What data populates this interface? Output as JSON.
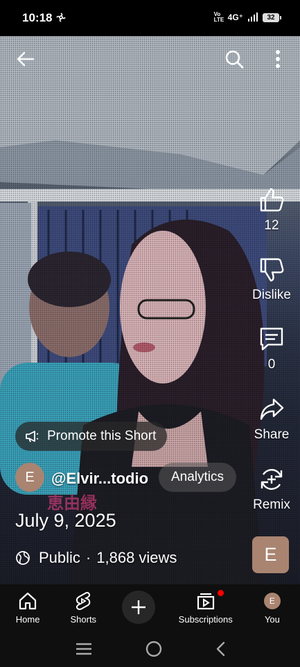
{
  "status_bar": {
    "time": "10:18",
    "network": "4G⁺",
    "volte": "Vo LTE",
    "battery": "32"
  },
  "top_bar": {
    "back_icon": "arrow-left-icon",
    "search_icon": "search-icon",
    "more_icon": "more-vertical-icon"
  },
  "actions": {
    "like_count": "12",
    "dislike_label": "Dislike",
    "comment_count": "0",
    "share_label": "Share",
    "remix_label": "Remix"
  },
  "promote": {
    "label": "Promote this Short",
    "icon": "megaphone-icon"
  },
  "channel": {
    "avatar_letter": "E",
    "handle": "@Elvir...todio",
    "analytics_label": "Analytics",
    "thumb_letter": "E"
  },
  "video_info": {
    "date": "July 9, 2025",
    "visibility": "Public",
    "separator": "·",
    "views": "1,868 views"
  },
  "bottom_nav": {
    "home": "Home",
    "shorts": "Shorts",
    "subscriptions": "Subscriptions",
    "you": "You",
    "you_avatar_letter": "E"
  },
  "colors": {
    "accent_red": "#ff0000",
    "avatar_bg": "#a98470",
    "nav_bg": "#0f0f0f"
  }
}
